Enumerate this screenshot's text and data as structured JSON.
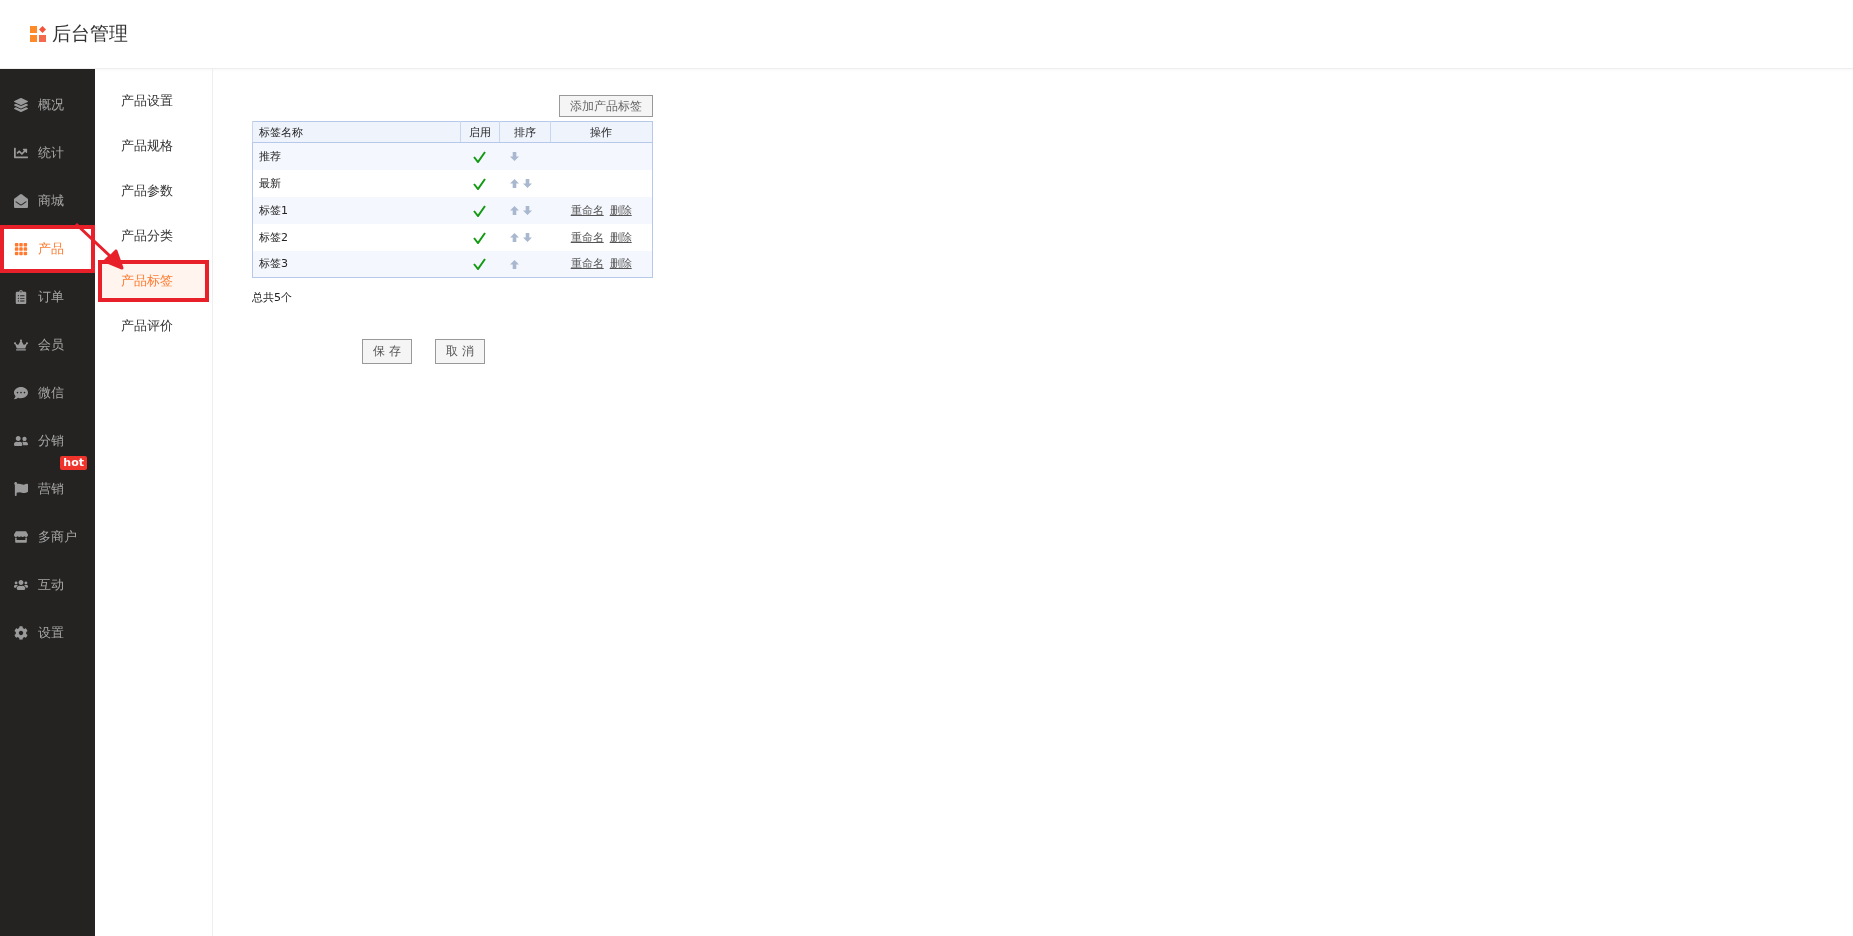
{
  "header": {
    "title": "后台管理"
  },
  "sidebar": {
    "items": [
      {
        "label": "概况",
        "selected": false,
        "marked": false
      },
      {
        "label": "统计",
        "selected": false,
        "marked": false
      },
      {
        "label": "商城",
        "selected": false,
        "marked": false
      },
      {
        "label": "产品",
        "selected": true,
        "marked": true
      },
      {
        "label": "订单",
        "selected": false,
        "marked": false
      },
      {
        "label": "会员",
        "selected": false,
        "marked": false
      },
      {
        "label": "微信",
        "selected": false,
        "marked": false
      },
      {
        "label": "分销",
        "selected": false,
        "marked": false
      },
      {
        "label": "营销",
        "selected": false,
        "marked": false,
        "badge": "hot"
      },
      {
        "label": "多商户",
        "selected": false,
        "marked": false
      },
      {
        "label": "互动",
        "selected": false,
        "marked": false
      },
      {
        "label": "设置",
        "selected": false,
        "marked": false
      }
    ]
  },
  "submenu": {
    "items": [
      {
        "label": "产品设置",
        "selected": false,
        "marked": false
      },
      {
        "label": "产品规格",
        "selected": false,
        "marked": false
      },
      {
        "label": "产品参数",
        "selected": false,
        "marked": false
      },
      {
        "label": "产品分类",
        "selected": false,
        "marked": false
      },
      {
        "label": "产品标签",
        "selected": true,
        "marked": true
      },
      {
        "label": "产品评价",
        "selected": false,
        "marked": false
      }
    ]
  },
  "annotation": {
    "arrow": true
  },
  "add_button": "添加产品标签",
  "table": {
    "columns": [
      "标签名称",
      "启用",
      "排序",
      "操作"
    ],
    "rows": [
      {
        "name": "推荐",
        "enabled": true,
        "can_move_up": false,
        "can_move_down": true,
        "actions": []
      },
      {
        "name": "最新",
        "enabled": true,
        "can_move_up": true,
        "can_move_down": true,
        "actions": []
      },
      {
        "name": "标签1",
        "enabled": true,
        "can_move_up": true,
        "can_move_down": true,
        "actions": [
          "重命名",
          "删除"
        ]
      },
      {
        "name": "标签2",
        "enabled": true,
        "can_move_up": true,
        "can_move_down": true,
        "actions": [
          "重命名",
          "删除"
        ]
      },
      {
        "name": "标签3",
        "enabled": true,
        "can_move_up": true,
        "can_move_down": false,
        "actions": [
          "重命名",
          "删除"
        ]
      }
    ]
  },
  "total": "总共5个",
  "buttons": [
    "保 存",
    "取 消"
  ]
}
